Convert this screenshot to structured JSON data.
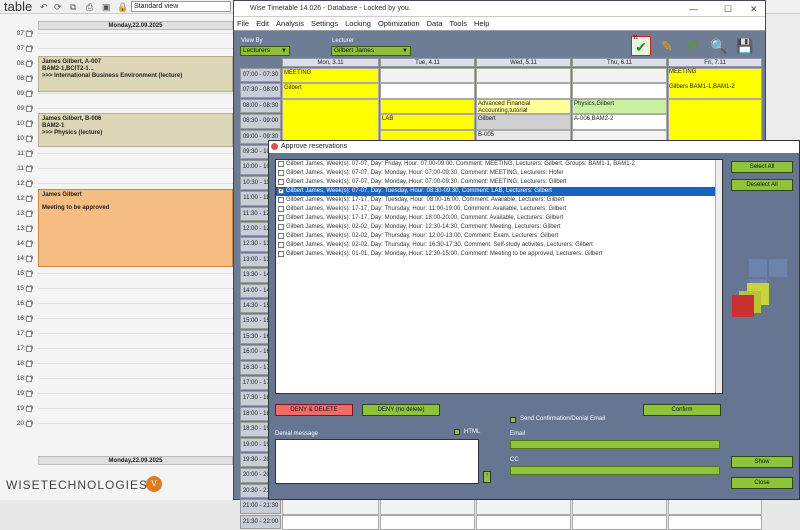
{
  "background": {
    "title": "table",
    "view_select": "Standard view",
    "day_header_top": "Monday,22.09.2025",
    "day_header_bottom": "Monday,22.09.2025",
    "hours": [
      "07:00",
      "07:30",
      "08:00",
      "08:30",
      "09:00",
      "09:30",
      "10:00",
      "10:30",
      "11:00",
      "11:30",
      "12:00",
      "12:30",
      "13:00",
      "13:30",
      "14:00",
      "14:30",
      "15:00",
      "15:30",
      "16:00",
      "16:30",
      "17:00",
      "17:30",
      "18:00",
      "18:30",
      "19:00",
      "19:30",
      "20:00"
    ],
    "events": [
      {
        "l1": "James Gilbert, A-007",
        "l2": "BAM2-1,BCIT2-1...",
        "l3": ">>> International Business Environment (lecture)",
        "color": "#dcd6b6"
      },
      {
        "l1": "James Gilbert, B-006",
        "l2": "BAM2-1",
        "l3": ">>> Physics (lecture)",
        "color": "#dcd6b6"
      },
      {
        "l1": "James Gilbert",
        "l2": "",
        "l3": "Meeting to be approved",
        "color": "#f6bd82"
      }
    ],
    "logo": "WISETECHNOLOGIES",
    "logo_badge": "V"
  },
  "window": {
    "title": "Wise Timetable 14.026 - Database - Locked by you.",
    "menu": [
      "File",
      "Edit",
      "Analysis",
      "Settings",
      "Locking",
      "Optimization",
      "Data",
      "Tools",
      "Help"
    ],
    "view_by_label": "View By",
    "view_by_value": "Lecturers",
    "lecturer_label": "Lecturer",
    "lecturer_value": "Gilbert James",
    "badge_count": "11",
    "days": [
      "Mon, 3.11",
      "Tue, 4.11",
      "Wed, 5.11",
      "Thu, 6.11",
      "Fri, 7.11"
    ],
    "times": [
      "07:00 - 07:30",
      "07:30 - 08:00",
      "08:00 - 08:30",
      "08:30 - 09:00",
      "09:00 - 09:30",
      "09:30 - 10:00",
      "10:00 - 10:30",
      "10:30 - 11:00",
      "11:00 - 11:30",
      "11:30 - 12:00",
      "12:00 - 12:30",
      "12:30 - 13:00",
      "13:00 - 13:30",
      "13:30 - 14:00",
      "14:00 - 14:30",
      "14:30 - 15:00",
      "15:00 - 15:30",
      "15:30 - 16:00",
      "16:00 - 16:30",
      "16:30 - 17:00",
      "17:00 - 17:30",
      "17:30 - 18:00",
      "18:00 - 18:30",
      "18:30 - 19:00",
      "19:00 - 19:30",
      "19:30 - 20:00",
      "20:00 - 20:30",
      "20:30 - 21:00",
      "21:00 - 21:30",
      "21:30 - 22:00"
    ],
    "cells": {
      "mon_meeting": "MEETING",
      "mon_gilbert": "Gilbert",
      "tue_lab": "LAB",
      "wed_aft": "Advanced Financial Accounting,tutorial",
      "wed_gilbert": "Gilbert",
      "wed_b005": "B-005",
      "thu_phys": "Physics,Gilbert",
      "thu_room": "A-006,BAM2-2",
      "fri_meeting": "MEETING",
      "fri_groups": "Gilbers BAM1-1,BAM1-2"
    }
  },
  "dialog": {
    "title": "Approve reservations",
    "rows": [
      {
        "text": "Gilbert James, Week(s): 07-07, Day: Friday, Hour: 07:00-09:00, Comment: MEETING, Lecturers: Gilbert, Groups: BAM1-1, BAM1-2",
        "checked": false
      },
      {
        "text": "Gilbert James, Week(s): 07-07, Day: Monday, Hour: 07:00-09:30, Comment: MEETING, Lecturers: Hofer",
        "checked": false
      },
      {
        "text": "Gilbert James, Week(s): 07-07, Day: Monday, Hour: 07:00-09:30, Comment: MEETING, Lecturers: Gilbert",
        "checked": false
      },
      {
        "text": "Gilbert James, Week(s): 07-07, Day: Tuesday, Hour: 08:30-09:30, Comment: LAB, Lecturers: Gilbert",
        "checked": true
      },
      {
        "text": "Gilbert James, Week(s): 17-17, Day: Tuesday, Hour: 08:00-16:00, Comment: Available, Lecturers: Gilbert",
        "checked": false
      },
      {
        "text": "Gilbert James, Week(s): 17-17, Day: Thursday, Hour: 11:00-19:00, Comment: Available, Lecturers: Gilbert",
        "checked": false
      },
      {
        "text": "Gilbert James, Week(s): 17-17, Day: Monday, Hour: 18:00-20:00, Comment: Available, Lecturers: Gilbert",
        "checked": false
      },
      {
        "text": "Gilbert James, Week(s): 02-02, Day: Monday, Hour: 12:30-14:30, Comment: Meeting, Lecturers: Gilbert",
        "checked": false
      },
      {
        "text": "Gilbert James, Week(s): 02-02, Day: Thursday, Hour: 12:00-13:00, Comment: Exam, Lecturers: Gilbert",
        "checked": false
      },
      {
        "text": "Gilbert James, Week(s): 02-02, Day: Thursday, Hour: 16:30-17:30, Comment: Self-study activites, Lecturers: Gilbert",
        "checked": false
      },
      {
        "text": "Gilbert James, Week(s): 01-01, Day: Monday, Hour: 12:30-15:00, Comment: Meeting to be approved, Lecturers: Gilbert",
        "checked": false
      }
    ],
    "selected_index": 3,
    "select_all": "Select All",
    "deselect_all": "Deselect All",
    "deny_delete": "DENY & DELETE",
    "deny_no_delete": "DENY (no delete)",
    "confirm": "Confirm",
    "send_label": "Send Confirmation/Denial Email",
    "denial_label": "Denial message",
    "html_label": "HTML",
    "email_label": "Email",
    "cc_label": "CC",
    "show": "Show",
    "close": "Close"
  }
}
